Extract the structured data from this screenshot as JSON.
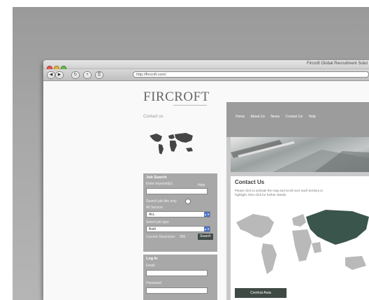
{
  "browser": {
    "window_title": "Fircroft Global Recruitment Solut",
    "url": "http://fircroft.com/",
    "back_glyph": "◀",
    "forward_glyph": "▶",
    "reload_glyph": "↻",
    "plus_glyph": "+",
    "bookmark_glyph": "☰"
  },
  "site": {
    "logo_text": "FIRCROFT",
    "contact_label": "Contact us",
    "nav": [
      "Home",
      "About Us",
      "News",
      "Contact Us",
      "Help"
    ]
  },
  "job_search": {
    "heading": "Job Search",
    "keywords_label": "Enter keyword(s)",
    "help_label": "Help",
    "search_title_only_label": "Search job title only",
    "sectors_label": "All Sectors",
    "sector_value": "ALL",
    "location_label": "Select job type",
    "location_value": "Both",
    "current_vacancies_label": "Current Vacancies:",
    "current_vacancies_count": "985",
    "search_button": "Search"
  },
  "login": {
    "heading": "Log In",
    "email_label": "Email",
    "password_label": "Password"
  },
  "main": {
    "title": "Contact Us",
    "body": "Please click to activate the map and scroll over each territory to highlight, then click for further details.",
    "region_button": "Central Asia"
  },
  "colors": {
    "accent_dark": "#3f4a45",
    "highlight_region": "#3a554b",
    "select_arrow": "#4b71c6"
  },
  "icons": {
    "world_map_small": "world-map-icon",
    "world_map_large": "world-map-icon"
  }
}
